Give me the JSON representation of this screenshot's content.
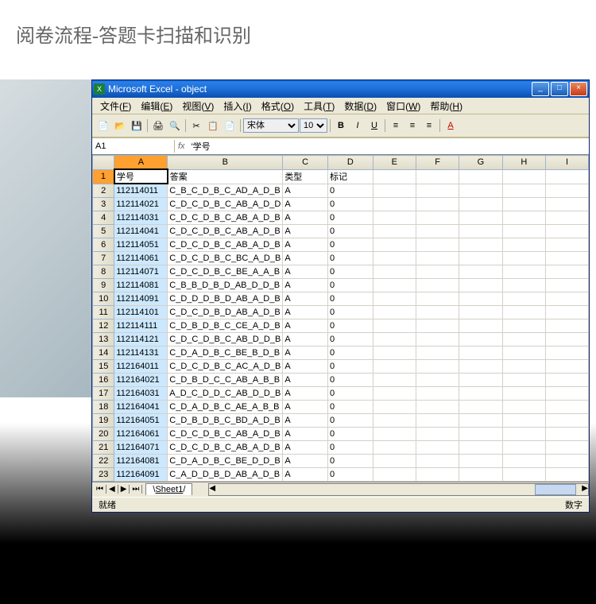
{
  "slide": {
    "title": "阅卷流程-答题卡扫描和识别"
  },
  "window": {
    "app": "Microsoft Excel",
    "doc": "object"
  },
  "menu": [
    {
      "label": "文件",
      "accel": "F"
    },
    {
      "label": "编辑",
      "accel": "E"
    },
    {
      "label": "视图",
      "accel": "V"
    },
    {
      "label": "插入",
      "accel": "I"
    },
    {
      "label": "格式",
      "accel": "O"
    },
    {
      "label": "工具",
      "accel": "T"
    },
    {
      "label": "数据",
      "accel": "D"
    },
    {
      "label": "窗口",
      "accel": "W"
    },
    {
      "label": "帮助",
      "accel": "H"
    }
  ],
  "toolbar2": {
    "font": "宋体",
    "size": "10"
  },
  "formula": {
    "name_box": "A1",
    "content": "'学号"
  },
  "columns": [
    "A",
    "B",
    "C",
    "D",
    "E",
    "F",
    "G",
    "H",
    "I"
  ],
  "headers": {
    "A": "学号",
    "B": "答案",
    "C": "类型",
    "D": "标记"
  },
  "rows": [
    {
      "n": 2,
      "A": "112114011",
      "B": "C_B_C_D_B_C_AD_A_D_B",
      "C": "A",
      "D": "0"
    },
    {
      "n": 3,
      "A": "112114021",
      "B": "C_D_C_D_B_C_AB_A_D_D",
      "C": "A",
      "D": "0"
    },
    {
      "n": 4,
      "A": "112114031",
      "B": "C_D_C_D_B_C_AB_A_D_B",
      "C": "A",
      "D": "0"
    },
    {
      "n": 5,
      "A": "112114041",
      "B": "C_D_C_D_B_C_AB_A_D_B",
      "C": "A",
      "D": "0"
    },
    {
      "n": 6,
      "A": "112114051",
      "B": "C_D_C_D_B_C_AB_A_D_B",
      "C": "A",
      "D": "0"
    },
    {
      "n": 7,
      "A": "112114061",
      "B": "C_D_C_D_B_C_BC_A_D_B",
      "C": "A",
      "D": "0"
    },
    {
      "n": 8,
      "A": "112114071",
      "B": "C_D_C_D_B_C_BE_A_A_B",
      "C": "A",
      "D": "0"
    },
    {
      "n": 9,
      "A": "112114081",
      "B": "C_B_B_D_B_D_AB_D_D_B",
      "C": "A",
      "D": "0"
    },
    {
      "n": 10,
      "A": "112114091",
      "B": "C_D_D_D_B_D_AB_A_D_B",
      "C": "A",
      "D": "0"
    },
    {
      "n": 11,
      "A": "112114101",
      "B": "C_D_C_D_B_D_AB_A_D_B",
      "C": "A",
      "D": "0"
    },
    {
      "n": 12,
      "A": "112114111",
      "B": "C_D_B_D_B_C_CE_A_D_B",
      "C": "A",
      "D": "0"
    },
    {
      "n": 13,
      "A": "112114121",
      "B": "C_D_C_D_B_C_AB_D_D_B",
      "C": "A",
      "D": "0"
    },
    {
      "n": 14,
      "A": "112114131",
      "B": "C_D_A_D_B_C_BE_B_D_B",
      "C": "A",
      "D": "0"
    },
    {
      "n": 15,
      "A": "112164011",
      "B": "C_D_C_D_B_C_AC_A_D_B",
      "C": "A",
      "D": "0"
    },
    {
      "n": 16,
      "A": "112164021",
      "B": "C_D_B_D_C_C_AB_A_B_B",
      "C": "A",
      "D": "0"
    },
    {
      "n": 17,
      "A": "112164031",
      "B": "A_D_C_D_D_C_AB_D_D_B",
      "C": "A",
      "D": "0"
    },
    {
      "n": 18,
      "A": "112164041",
      "B": "C_D_A_D_B_C_AE_A_B_B",
      "C": "A",
      "D": "0"
    },
    {
      "n": 19,
      "A": "112164051",
      "B": "C_D_B_D_B_C_BD_A_D_B",
      "C": "A",
      "D": "0"
    },
    {
      "n": 20,
      "A": "112164061",
      "B": "C_D_C_D_B_C_AB_A_D_B",
      "C": "A",
      "D": "0"
    },
    {
      "n": 21,
      "A": "112164071",
      "B": "C_D_C_D_B_C_AB_A_D_B",
      "C": "A",
      "D": "0"
    },
    {
      "n": 22,
      "A": "112164081",
      "B": "C_D_A_D_B_C_BE_D_D_B",
      "C": "A",
      "D": "0"
    },
    {
      "n": 23,
      "A": "112164091",
      "B": "C_A_D_D_B_D_AB_A_D_B",
      "C": "A",
      "D": "0"
    }
  ],
  "sheet_tab": "Sheet1",
  "status": {
    "ready": "就绪",
    "mode": "数字"
  }
}
